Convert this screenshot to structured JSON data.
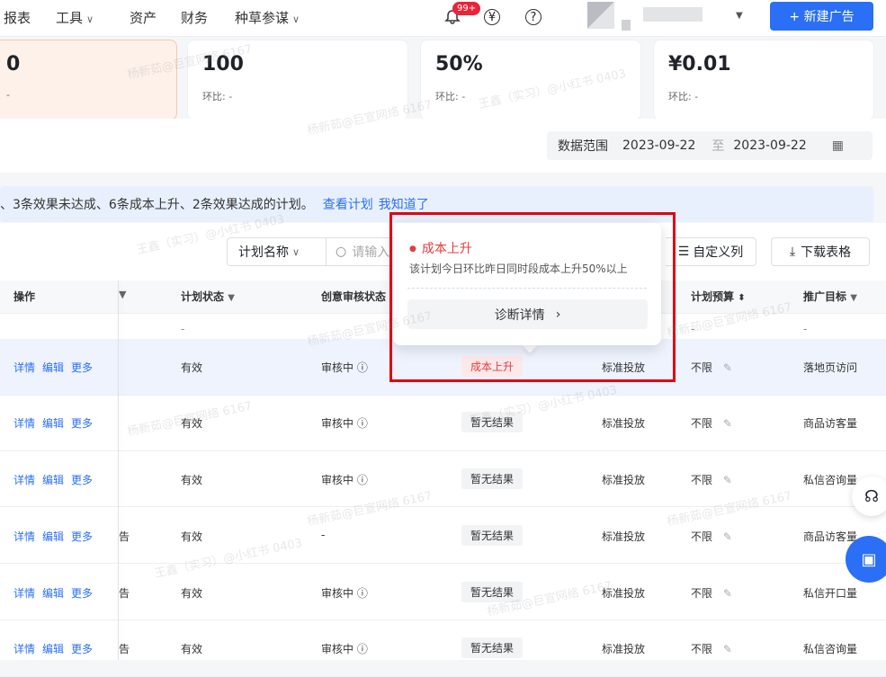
{
  "nav": {
    "items": [
      "报表",
      "工具",
      "资产",
      "财务",
      "种草参谋"
    ],
    "badge": "99+",
    "new_ad": "+ 新建广告"
  },
  "kpis": [
    {
      "value": "0",
      "sub": "-"
    },
    {
      "value": "100",
      "sub": "环比: -"
    },
    {
      "value": "50%",
      "sub": "环比: -"
    },
    {
      "value": "¥0.01",
      "sub": "环比: -"
    }
  ],
  "date_range": {
    "label": "数据范围",
    "start": "2023-09-22",
    "sep": "至",
    "end": "2023-09-22"
  },
  "notice": {
    "text": "、3条效果未达成、6条成本上升、2条效果达成的计划。",
    "link1": "查看计划",
    "link2": "我知道了"
  },
  "toolbar": {
    "select": "计划名称",
    "search_placeholder": "请输入",
    "custom_cols": "自定义列",
    "download": "下载表格"
  },
  "columns": {
    "actions": "操作",
    "status": "计划状态",
    "review": "创意审核状态",
    "budget": "计划预算",
    "goal": "推广目标"
  },
  "filter_row": {
    "status": "-",
    "budget": "-",
    "goal": "-"
  },
  "row_actions": {
    "detail": "详情",
    "edit": "编辑",
    "more": "更多"
  },
  "rows": [
    {
      "col2": "",
      "status": "有效",
      "review": "审核中",
      "diag": "成本上升",
      "mode": "标准投放",
      "budget": "不限",
      "goal": "落地页访问"
    },
    {
      "col2": "",
      "status": "有效",
      "review": "审核中",
      "diag": "暂无结果",
      "mode": "标准投放",
      "budget": "不限",
      "goal": "商品访客量"
    },
    {
      "col2": "",
      "status": "有效",
      "review": "审核中",
      "diag": "暂无结果",
      "mode": "标准投放",
      "budget": "不限",
      "goal": "私信咨询量"
    },
    {
      "col2": "告",
      "status": "有效",
      "review": "-",
      "diag": "暂无结果",
      "mode": "标准投放",
      "budget": "不限",
      "goal": "商品访客量"
    },
    {
      "col2": "告",
      "status": "有效",
      "review": "审核中",
      "diag": "暂无结果",
      "mode": "标准投放",
      "budget": "不限",
      "goal": "私信开口量"
    },
    {
      "col2": "告",
      "status": "有效",
      "review": "审核中",
      "diag": "暂无结果",
      "mode": "标准投放",
      "budget": "不限",
      "goal": "私信咨询量"
    }
  ],
  "popover": {
    "title": "成本上升",
    "desc": "该计划今日环比昨日同时段成本上升50%以上",
    "button": "诊断详情"
  },
  "colors": {
    "primary": "#2a6ff5",
    "danger": "#e33c3c",
    "highlight": "#e10012"
  }
}
